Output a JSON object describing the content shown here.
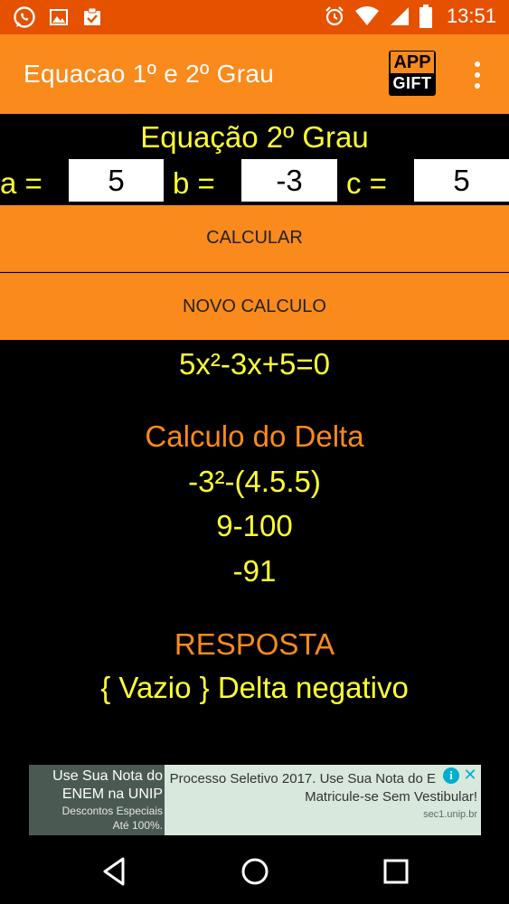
{
  "status_bar": {
    "time": "13:51",
    "left_icons": [
      "whatsapp-icon",
      "image-icon",
      "clipboard-check-icon"
    ],
    "right_icons": [
      "alarm-icon",
      "wifi-icon",
      "signal-icon",
      "battery-icon"
    ]
  },
  "app_bar": {
    "title": "Equacao 1º e 2º Grau",
    "logo_top": "APP",
    "logo_bottom": "GIFT"
  },
  "form": {
    "title": "Equação 2º Grau",
    "a_label": "a =",
    "a_value": "5",
    "b_label": "b =",
    "b_value": "-3",
    "c_label": "c =",
    "c_value": "5",
    "calculate_label": "CALCULAR",
    "new_calc_label": "NOVO CALCULO"
  },
  "result": {
    "equation": "5x²-3x+5=0",
    "delta_heading": "Calculo do Delta",
    "delta_step1": "-3²-(4.5.5)",
    "delta_step2": "9-100",
    "delta_result": "-91",
    "answer_heading": "RESPOSTA",
    "answer": "{ Vazio } Delta negativo"
  },
  "ad": {
    "left_line1": "Use Sua Nota do",
    "left_line2": "ENEM na UNIP",
    "left_line3": "Descontos Especiais",
    "left_line4": "Até 100%.",
    "right_line1": "Processo Seletivo 2017. Use Sua Nota do E",
    "right_line2": "Matricule-se Sem Vestibular!",
    "right_line3": "sec1.unip.br",
    "info_glyph": "i",
    "close_glyph": "✕"
  },
  "colors": {
    "accent_orange": "#f98a1b",
    "status_orange": "#e65100",
    "text_yellow": "#ffff33"
  }
}
